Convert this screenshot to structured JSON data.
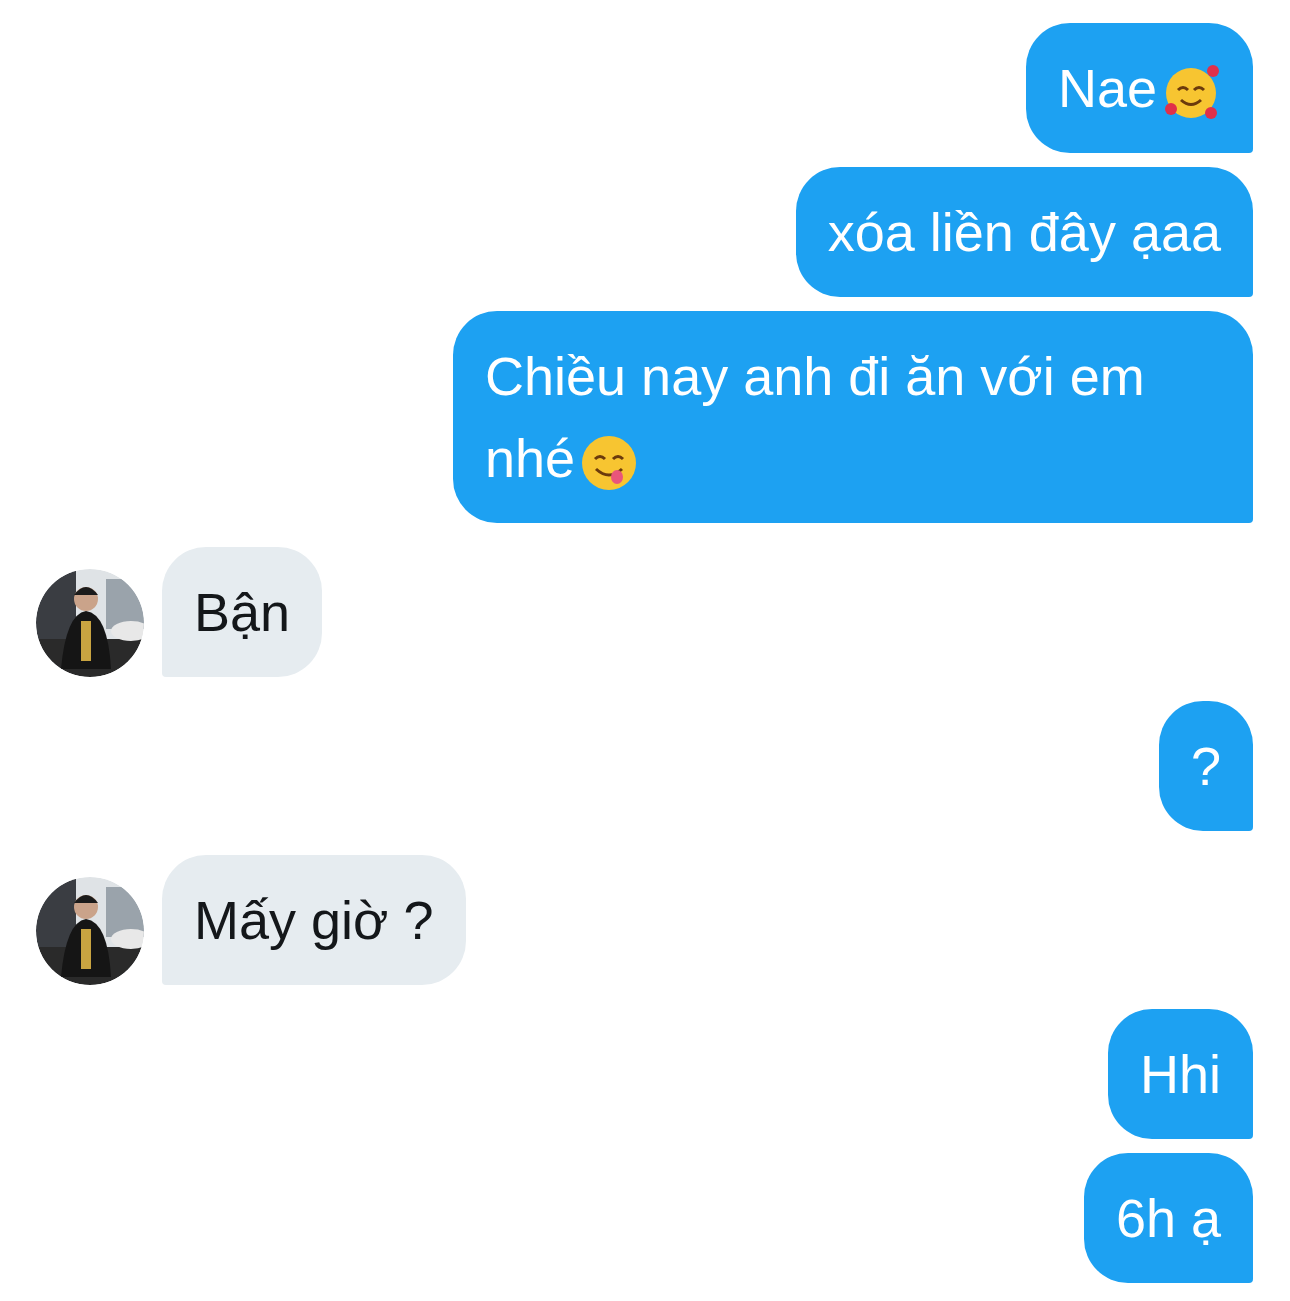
{
  "messages": [
    {
      "kind": "sent-hearts",
      "text": "Nae"
    },
    {
      "kind": "sent",
      "text": "xóa liền đây ạaa"
    },
    {
      "kind": "sent-yum",
      "text": "Chiều nay anh đi ăn với em nhé"
    },
    {
      "kind": "received",
      "text": "Bận"
    },
    {
      "kind": "sent",
      "text": "?"
    },
    {
      "kind": "received",
      "text": "Mấy giờ ?"
    },
    {
      "kind": "sent",
      "text": "Hhi"
    },
    {
      "kind": "sent",
      "text": "6h ạ"
    }
  ]
}
